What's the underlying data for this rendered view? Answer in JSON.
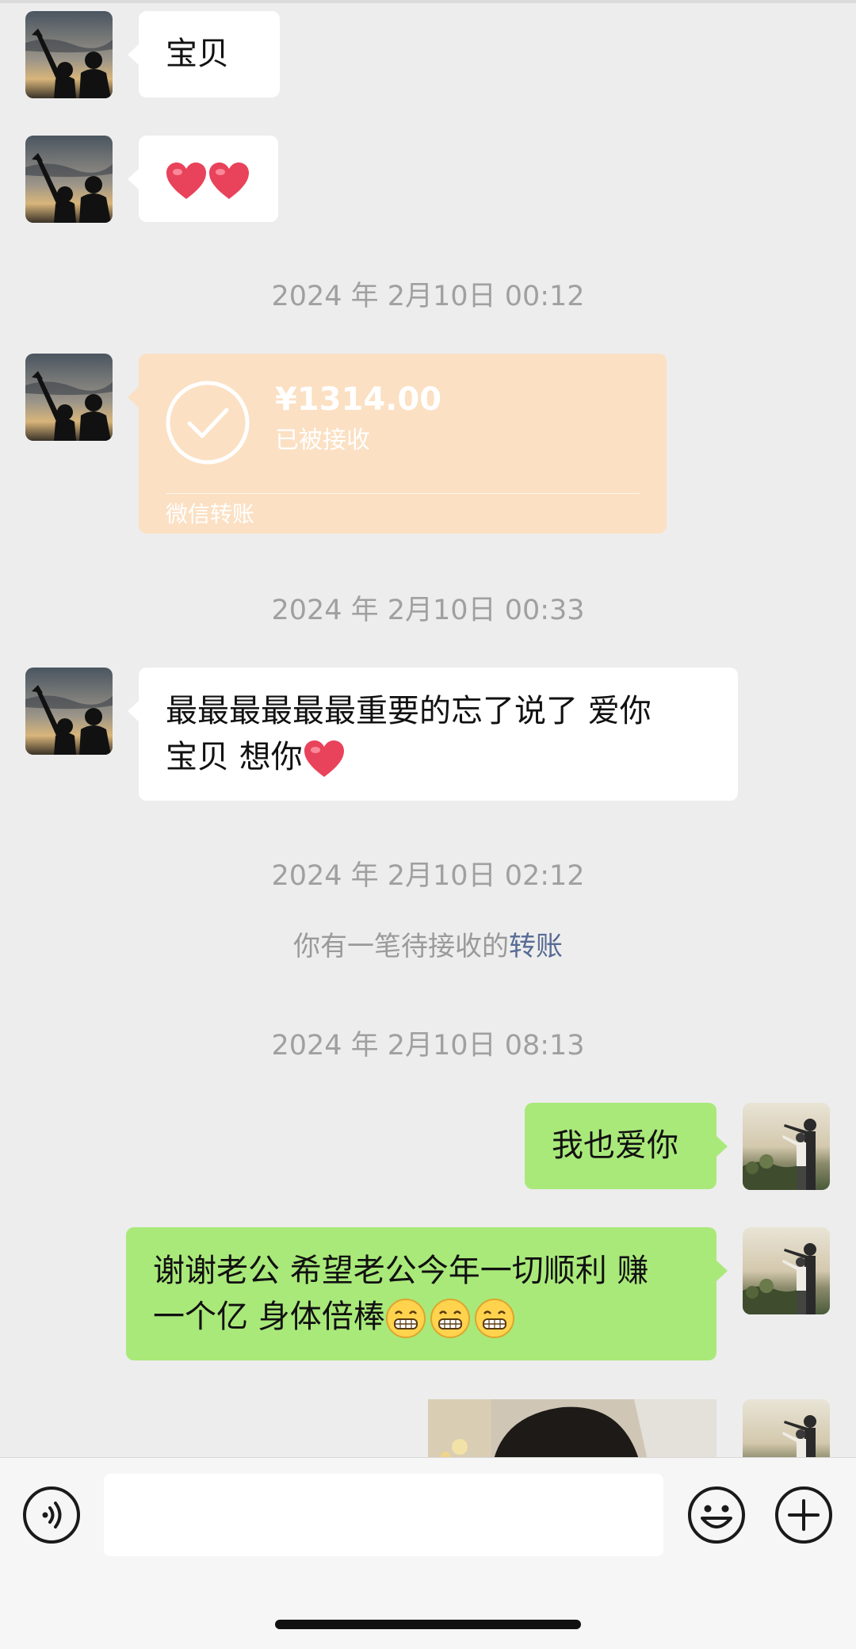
{
  "messages": {
    "m1": "宝贝",
    "m3_line1": "最最最最最最重要的忘了说了   爱你",
    "m3_line2": "宝贝  想你",
    "m4": "我也爱你",
    "m5_line1": "谢谢老公 希望老公今年一切顺利 赚",
    "m5_line2": "一个亿 身体倍棒"
  },
  "timestamps": {
    "t1": "2024 年 2月10日 00:12",
    "t2": "2024 年 2月10日 00:33",
    "t3": "2024 年 2月10日 02:12",
    "t4": "2024 年 2月10日 08:13"
  },
  "transfer": {
    "amount": "¥1314.00",
    "status": "已被接收",
    "label": "微信转账",
    "color": "#fbe0c3"
  },
  "system": {
    "pending_text": "你有一笔待接收的",
    "pending_link": "转账",
    "link_color": "#576b95"
  },
  "icons": {
    "voice": "voice-icon",
    "emoji": "emoji-icon",
    "plus": "plus-icon",
    "heart": "heart-emoji",
    "grin": "grin-emoji"
  },
  "colors": {
    "background": "#ededed",
    "incoming_bubble": "#ffffff",
    "outgoing_bubble": "#a9e97a"
  }
}
